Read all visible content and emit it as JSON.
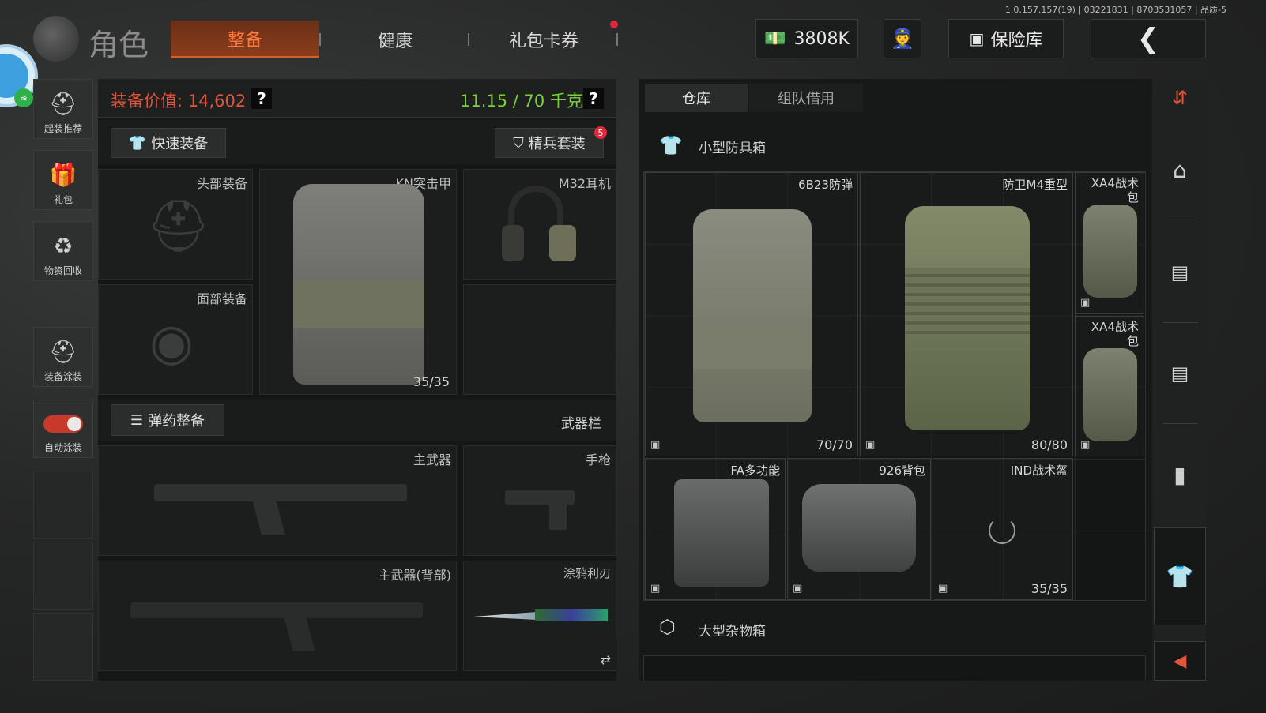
{
  "app": {
    "version": "1.0.157.157(19) | 03221831 | 8703531057 | 品质-5",
    "title": "角色"
  },
  "tabs": [
    {
      "label": "整备",
      "active": true
    },
    {
      "label": "健康",
      "active": false
    },
    {
      "label": "礼包卡券",
      "active": false
    }
  ],
  "topbar": {
    "currency": "3808K",
    "vault_label": "保险库"
  },
  "sidebar": {
    "items": [
      {
        "label": "起装推荐",
        "icon": "helmet-icon"
      },
      {
        "label": "礼包",
        "icon": "gift-icon"
      },
      {
        "label": "物资回收",
        "icon": "recycle-icon"
      },
      {
        "label": "装备涂装",
        "icon": "paint-helmet-icon"
      },
      {
        "label": "自动涂装",
        "icon": "toggle-icon",
        "on": true
      }
    ]
  },
  "loadout": {
    "value_label": "装备价值: 14,602",
    "weight_label": "11.15 / 70 千克",
    "quick_equip": "快速装备",
    "elite_set": "精兵套装",
    "elite_badge": "5",
    "slots": {
      "head": "头部装备",
      "face": "面部装备",
      "armor": "KN突击甲",
      "armor_count": "35/35",
      "headset": "M32耳机"
    },
    "ammo_button": "弹药整备",
    "weapon_bar": "武器栏",
    "weapons": {
      "primary": "主武器",
      "pistol": "手枪",
      "primary_back": "主武器(背部)",
      "melee": "涂鸦利刃",
      "swap_icon": "⇄"
    }
  },
  "storage": {
    "tabs": [
      {
        "label": "仓库",
        "active": true
      },
      {
        "label": "组队借用",
        "active": false
      }
    ],
    "box1_title": "小型防具箱",
    "box2_title": "大型杂物箱",
    "items": [
      {
        "name": "6B23防弹",
        "count": "70/70"
      },
      {
        "name": "防卫M4重型",
        "count": "80/80"
      },
      {
        "name": "XA4战术包",
        "count": ""
      },
      {
        "name": "XA4战术包",
        "count": ""
      },
      {
        "name": "FA多功能",
        "count": ""
      },
      {
        "name": "926背包",
        "count": ""
      },
      {
        "name": "IND战术盔",
        "count": "35/35"
      }
    ]
  },
  "colors": {
    "accent": "#d0602a",
    "value_red": "#e2553a",
    "weight_green": "#7bd13b",
    "nav_active": "#e2553a"
  }
}
